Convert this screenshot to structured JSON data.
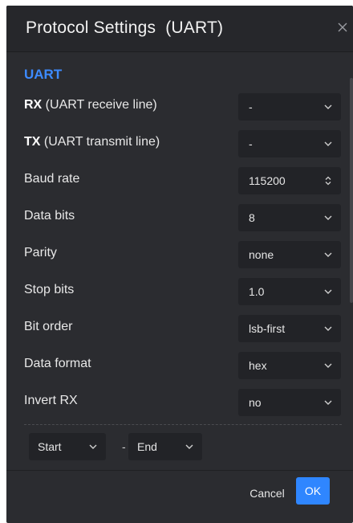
{
  "dialog": {
    "title": "Protocol Settings  (UART)",
    "close_icon": "close-icon"
  },
  "section": {
    "title": "UART"
  },
  "rows": [
    {
      "label_bold": "RX",
      "label": " (UART receive line)",
      "value": "-",
      "control": "select"
    },
    {
      "label_bold": "TX",
      "label": " (UART transmit line)",
      "value": "-",
      "control": "select"
    },
    {
      "label_bold": "",
      "label": "Baud rate",
      "value": "115200",
      "control": "spin"
    },
    {
      "label_bold": "",
      "label": "Data bits",
      "value": "8",
      "control": "select"
    },
    {
      "label_bold": "",
      "label": "Parity",
      "value": "none",
      "control": "select"
    },
    {
      "label_bold": "",
      "label": "Stop bits",
      "value": "1.0",
      "control": "select"
    },
    {
      "label_bold": "",
      "label": "Bit order",
      "value": "lsb-first",
      "control": "select"
    },
    {
      "label_bold": "",
      "label": "Data format",
      "value": "hex",
      "control": "select"
    },
    {
      "label_bold": "",
      "label": "Invert RX",
      "value": "no",
      "control": "select"
    }
  ],
  "range": {
    "start": "Start",
    "separator": "-",
    "end": "End"
  },
  "footer": {
    "cancel_label": "Cancel",
    "ok_label": "OK"
  },
  "colors": {
    "dialog_bg": "#2b2c30",
    "accent": "#2f86ff",
    "section_title": "#3d8bff"
  }
}
